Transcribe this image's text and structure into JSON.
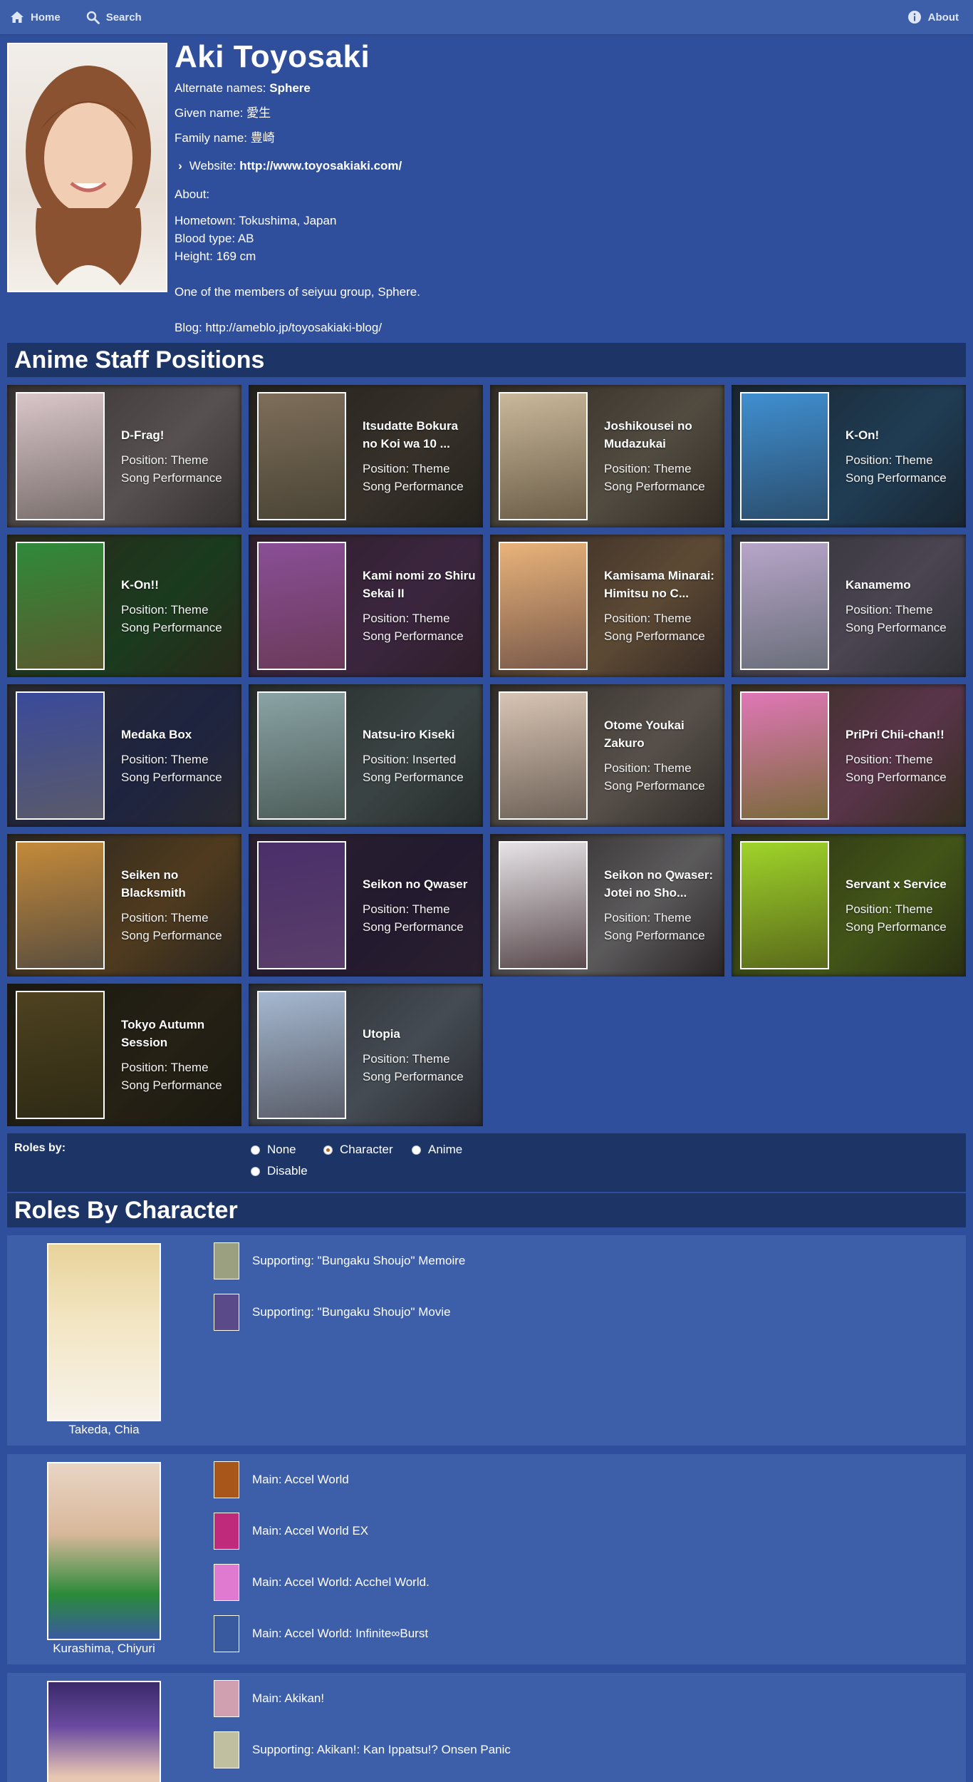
{
  "nav": {
    "home": "Home",
    "search": "Search",
    "about": "About"
  },
  "person": {
    "name": "Aki Toyosaki",
    "alt_label": "Alternate names:",
    "alt_value": "Sphere",
    "given_label": "Given name:",
    "given_value": "愛生",
    "family_label": "Family name:",
    "family_value": "豊崎",
    "website_label": "Website:",
    "website_value": "http://www.toyosakiaki.com/",
    "about_label": "About:",
    "about_text": "Hometown: Tokushima, Japan\nBlood type: AB\nHeight: 169 cm\n\nOne of the members of seiyuu group, Sphere.\n\nBlog: http://ameblo.jp/toyosakiaki-blog/"
  },
  "staff": {
    "header": "Anime Staff Positions",
    "cards": [
      {
        "title": "D-Frag!",
        "position": "Position: Theme Song Performance",
        "color": "#d9c6c9",
        "bg": "#7a6f6d"
      },
      {
        "title": "Itsudatte Bokura no Koi wa 10 ...",
        "position": "Position: Theme Song Performance",
        "color": "#7e6e5a",
        "bg": "#4a4435"
      },
      {
        "title": "Joshikousei no Mudazukai",
        "position": "Position: Theme Song Performance",
        "color": "#c9b89a",
        "bg": "#6d5e49"
      },
      {
        "title": "K-On!",
        "position": "Position: Theme Song Performance",
        "color": "#3f8fd0",
        "bg": "#2b4e6e"
      },
      {
        "title": "K-On!!",
        "position": "Position: Theme Song Performance",
        "color": "#2f8a3a",
        "bg": "#5a5a2e"
      },
      {
        "title": "Kami nomi zo Shiru Sekai II",
        "position": "Position: Theme Song Performance",
        "color": "#8a4f96",
        "bg": "#6a3a5a"
      },
      {
        "title": "Kamisama Minarai: Himitsu no C...",
        "position": "Position: Theme Song Performance",
        "color": "#e9b37a",
        "bg": "#7a5a4a"
      },
      {
        "title": "Kanamemo",
        "position": "Position: Theme Song Performance",
        "color": "#b7a5c9",
        "bg": "#6a6e7a"
      },
      {
        "title": "Medaka Box",
        "position": "Position: Theme Song Performance",
        "color": "#3a4a9a",
        "bg": "#5a5a6a"
      },
      {
        "title": "Natsu-iro Kiseki",
        "position": "Position: Inserted Song Performance",
        "color": "#8aa3a5",
        "bg": "#4e5e5a"
      },
      {
        "title": "Otome Youkai Zakuro",
        "position": "Position: Theme Song Performance",
        "color": "#d8c4b4",
        "bg": "#6e6258"
      },
      {
        "title": "PriPri Chii-chan!!",
        "position": "Position: Theme Song Performance",
        "color": "#e077b6",
        "bg": "#7a6a3a"
      },
      {
        "title": "Seiken no Blacksmith",
        "position": "Position: Theme Song Performance",
        "color": "#c48a3a",
        "bg": "#5a4e3e"
      },
      {
        "title": "Seikon no Qwaser",
        "position": "Position: Theme Song Performance",
        "color": "#4a2f6a",
        "bg": "#5a3e6a"
      },
      {
        "title": "Seikon no Qwaser: Jotei no Sho...",
        "position": "Position: Theme Song Performance",
        "color": "#e6e3e6",
        "bg": "#5a4a4e"
      },
      {
        "title": "Servant x Service",
        "position": "Position: Theme Song Performance",
        "color": "#9fd42a",
        "bg": "#5a6a1a"
      },
      {
        "title": "Tokyo Autumn Session",
        "position": "Position: Theme Song Performance",
        "color": "#4e4220",
        "bg": "#2e2a14"
      },
      {
        "title": "Utopia",
        "position": "Position: Theme Song Performance",
        "color": "#a5b8d0",
        "bg": "#5a5e6a"
      }
    ]
  },
  "roles_by": {
    "label": "Roles by:",
    "options": [
      "None",
      "Character",
      "Anime",
      "Disable"
    ],
    "selected": "Character"
  },
  "characters": {
    "header": "Roles By Character",
    "list": [
      {
        "name": "Takeda, Chia",
        "color": "#f3e6c4",
        "roles": [
          {
            "text": "Supporting: \"Bungaku Shoujo\" Memoire",
            "thumb": "#9aa080"
          },
          {
            "text": "Supporting: \"Bungaku Shoujo\" Movie",
            "thumb": "#5a4a8a"
          }
        ]
      },
      {
        "name": "Kurashima, Chiyuri",
        "color": "#d9b89a",
        "roles": [
          {
            "text": "Main: Accel World",
            "thumb": "#a8561a"
          },
          {
            "text": "Main: Accel World EX",
            "thumb": "#c02a7a"
          },
          {
            "text": "Main: Accel World: Acchel World.",
            "thumb": "#e07ad0"
          },
          {
            "text": "Main: Accel World: Infinite∞Burst",
            "thumb": "#3a5aa0"
          }
        ]
      },
      {
        "name": "",
        "color": "#6a4aa0",
        "roles": [
          {
            "text": "Main: Akikan!",
            "thumb": "#d0a0b0"
          },
          {
            "text": "Supporting: Akikan!: Kan Ippatsu!? Onsen Panic",
            "thumb": "#c0c0a0"
          }
        ]
      }
    ]
  }
}
